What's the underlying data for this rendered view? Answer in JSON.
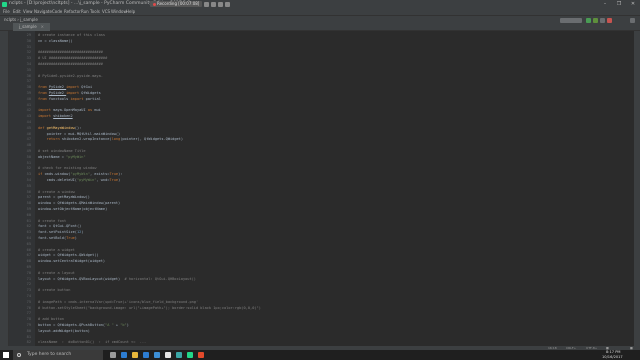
{
  "window": {
    "title": "nclpts - [D:\\project\\ncltpts] - ...\\j_sample - PyCharm Community Edition 2017.2.3",
    "recording_label": "Recording [00:07:08]",
    "icons": [
      "app-icon",
      "record-dot-icon",
      "pause-icon",
      "stop-icon",
      "camera-icon",
      "close-recording-icon"
    ],
    "controls": [
      "–",
      "❐",
      "✕"
    ]
  },
  "menu": [
    "File",
    "Edit",
    "View",
    "Navigate",
    "Code",
    "Refactor",
    "Run",
    "Tools",
    "VCS",
    "Window",
    "Help"
  ],
  "toolbar": {
    "breadcrumb": "nclpts  ›  j_sample",
    "icons": [
      "run-config-icon",
      "run-icon",
      "debug-icon",
      "coverage-icon",
      "stop-icon",
      "search-icon"
    ]
  },
  "tab": {
    "label": "j_sample",
    "close": "×"
  },
  "editor": {
    "lines": [
      {
        "n": "29",
        "parts": [
          {
            "t": "# create instance of this class",
            "c": "c-comment"
          }
        ]
      },
      {
        "n": "30",
        "parts": [
          {
            "t": "cn = className()",
            "c": ""
          }
        ]
      },
      {
        "n": "31",
        "parts": []
      },
      {
        "n": "32",
        "parts": [
          {
            "t": "##############################",
            "c": "c-comment"
          }
        ]
      },
      {
        "n": "33",
        "parts": [
          {
            "t": "# UI ###########################",
            "c": "c-comment"
          }
        ]
      },
      {
        "n": "34",
        "parts": [
          {
            "t": "##############################",
            "c": "c-comment"
          }
        ]
      },
      {
        "n": "35",
        "parts": []
      },
      {
        "n": "36",
        "parts": [
          {
            "t": "# PySide6-pyside2-pyside-maya-",
            "c": "c-comment"
          }
        ]
      },
      {
        "n": "37",
        "parts": []
      },
      {
        "n": "38",
        "parts": [
          {
            "t": "from ",
            "c": "c-kw"
          },
          {
            "t": "PySide2 ",
            "c": "c-ul"
          },
          {
            "t": "import ",
            "c": "c-kw"
          },
          {
            "t": "QtGui",
            "c": ""
          }
        ]
      },
      {
        "n": "39",
        "parts": [
          {
            "t": "from ",
            "c": "c-kw"
          },
          {
            "t": "PySide2 ",
            "c": "c-ul"
          },
          {
            "t": "import ",
            "c": "c-kw"
          },
          {
            "t": "QtWidgets",
            "c": ""
          }
        ]
      },
      {
        "n": "40",
        "parts": [
          {
            "t": "from ",
            "c": "c-kw"
          },
          {
            "t": "functools ",
            "c": ""
          },
          {
            "t": "import ",
            "c": "c-kw"
          },
          {
            "t": "partial",
            "c": ""
          }
        ]
      },
      {
        "n": "41",
        "parts": []
      },
      {
        "n": "42",
        "parts": [
          {
            "t": "import ",
            "c": "c-kw"
          },
          {
            "t": "maya.OpenMayaUI ",
            "c": ""
          },
          {
            "t": "as ",
            "c": "c-kw"
          },
          {
            "t": "mui",
            "c": ""
          }
        ]
      },
      {
        "n": "43",
        "parts": [
          {
            "t": "import ",
            "c": "c-kw"
          },
          {
            "t": "shiboken2",
            "c": "c-ul"
          }
        ]
      },
      {
        "n": "44",
        "parts": []
      },
      {
        "n": "45",
        "parts": [
          {
            "t": "def ",
            "c": "c-kw"
          },
          {
            "t": "getMayaWindow",
            "c": "c-fn"
          },
          {
            "t": "():",
            "c": ""
          }
        ]
      },
      {
        "n": "46",
        "parts": [
          {
            "t": "    pointer = mui.MQtUtil.mainWindow()",
            "c": ""
          }
        ]
      },
      {
        "n": "47",
        "parts": [
          {
            "t": "    return ",
            "c": "c-kw"
          },
          {
            "t": "shiboken2.wrapInstance(",
            "c": ""
          },
          {
            "t": "long",
            "c": "c-kw"
          },
          {
            "t": "(pointer), QtWidgets.QWidget)",
            "c": ""
          }
        ]
      },
      {
        "n": "48",
        "parts": []
      },
      {
        "n": "49",
        "parts": [
          {
            "t": "# set windowName Title",
            "c": "c-comment"
          }
        ]
      },
      {
        "n": "50",
        "parts": [
          {
            "t": "objectName = ",
            "c": ""
          },
          {
            "t": "\"pyMyWin\"",
            "c": "c-str"
          }
        ]
      },
      {
        "n": "51",
        "parts": []
      },
      {
        "n": "52",
        "parts": [
          {
            "t": "# check for existing window",
            "c": "c-comment"
          }
        ]
      },
      {
        "n": "53",
        "parts": [
          {
            "t": "if ",
            "c": "c-kw"
          },
          {
            "t": "cmds.window(",
            "c": ""
          },
          {
            "t": "\"pyMyWin\"",
            "c": "c-str"
          },
          {
            "t": ", exists=",
            "c": ""
          },
          {
            "t": "True",
            "c": "c-kw"
          },
          {
            "t": "):",
            "c": ""
          }
        ]
      },
      {
        "n": "54",
        "parts": [
          {
            "t": "    cmds.deleteUI(",
            "c": ""
          },
          {
            "t": "\"pyMyWin\"",
            "c": "c-str"
          },
          {
            "t": ", wnd=",
            "c": ""
          },
          {
            "t": "True",
            "c": "c-kw"
          },
          {
            "t": ")",
            "c": ""
          }
        ]
      },
      {
        "n": "55",
        "parts": []
      },
      {
        "n": "56",
        "parts": [
          {
            "t": "# create a window",
            "c": "c-comment"
          }
        ]
      },
      {
        "n": "57",
        "parts": [
          {
            "t": "parent = getMayaWindow()",
            "c": ""
          }
        ]
      },
      {
        "n": "58",
        "parts": [
          {
            "t": "window = QtWidgets.QMainWindow(parent)",
            "c": ""
          }
        ]
      },
      {
        "n": "59",
        "parts": [
          {
            "t": "window.setObjectName(objectName)",
            "c": ""
          }
        ]
      },
      {
        "n": "60",
        "parts": []
      },
      {
        "n": "61",
        "parts": [
          {
            "t": "# create font",
            "c": "c-comment"
          }
        ]
      },
      {
        "n": "62",
        "parts": [
          {
            "t": "font = QtGui.QFont()",
            "c": ""
          }
        ]
      },
      {
        "n": "63",
        "parts": [
          {
            "t": "font.setPointSize(",
            "c": ""
          },
          {
            "t": "12",
            "c": "c-num"
          },
          {
            "t": ")",
            "c": ""
          }
        ]
      },
      {
        "n": "64",
        "parts": [
          {
            "t": "font.setBold(",
            "c": ""
          },
          {
            "t": "True",
            "c": "c-kw"
          },
          {
            "t": ")",
            "c": ""
          }
        ]
      },
      {
        "n": "65",
        "parts": []
      },
      {
        "n": "66",
        "parts": [
          {
            "t": "# create a widget",
            "c": "c-comment"
          }
        ]
      },
      {
        "n": "67",
        "parts": [
          {
            "t": "widget = QtWidgets.QWidget()",
            "c": ""
          }
        ]
      },
      {
        "n": "68",
        "parts": [
          {
            "t": "window.setCentralWidget(widget)",
            "c": ""
          }
        ]
      },
      {
        "n": "69",
        "parts": []
      },
      {
        "n": "70",
        "parts": [
          {
            "t": "# create a layout",
            "c": "c-comment"
          }
        ]
      },
      {
        "n": "71",
        "parts": [
          {
            "t": "layout = QtWidgets.QVBoxLayout(widget)  ",
            "c": ""
          },
          {
            "t": "# horizontal: QtGui.QHBoxLayout()",
            "c": "c-comment"
          }
        ]
      },
      {
        "n": "72",
        "parts": []
      },
      {
        "n": "73",
        "parts": [
          {
            "t": "# create button",
            "c": "c-comment"
          }
        ]
      },
      {
        "n": "74",
        "parts": []
      },
      {
        "n": "75",
        "parts": [
          {
            "t": "# imagePath = cmds.internalVar(upd=True)+'icons/blue_field_background.png'",
            "c": "c-comment"
          }
        ]
      },
      {
        "n": "76",
        "parts": [
          {
            "t": "# button.setStyleSheet(\"background-image: url(\"+imagePath+\"); border:solid black 1px;color:rgb(0,0,0)\")",
            "c": "c-comment"
          }
        ]
      },
      {
        "n": "77",
        "parts": []
      },
      {
        "n": "78",
        "parts": [
          {
            "t": "# add button",
            "c": "c-comment"
          }
        ]
      },
      {
        "n": "79",
        "parts": [
          {
            "t": "button = QtWidgets.QPushButton(",
            "c": ""
          },
          {
            "t": "\"A \" ",
            "c": "c-str"
          },
          {
            "t": "+ ",
            "c": ""
          },
          {
            "t": "\"b\"",
            "c": "c-str"
          },
          {
            "t": ")",
            "c": ""
          }
        ]
      },
      {
        "n": "80",
        "parts": [
          {
            "t": "layout.addWidget(button)",
            "c": ""
          }
        ]
      },
      {
        "n": "81",
        "parts": []
      },
      {
        "n": "82",
        "parts": [
          {
            "t": "className  ›  doButton01()  ›  if cmdCount <=  ...",
            "c": "c-comment"
          }
        ]
      }
    ]
  },
  "status": {
    "position": "16:18",
    "line_sep": "CRLF÷",
    "encoding": "UTF-8÷",
    "icons": [
      "lock-icon",
      "event-log-icon"
    ]
  },
  "taskbar": {
    "search_placeholder": "Type here to search",
    "apps": [
      {
        "name": "task-view-icon",
        "color": "#9a9a9a"
      },
      {
        "name": "edge-icon",
        "color": "#2d7dd2"
      },
      {
        "name": "explorer-icon",
        "color": "#e8b73c"
      },
      {
        "name": "store-icon",
        "color": "#2d7dd2"
      },
      {
        "name": "mail-icon",
        "color": "#3d8fd6"
      },
      {
        "name": "unreal-icon",
        "color": "#e6e6e6"
      },
      {
        "name": "maya-icon",
        "color": "#3aa6a6"
      },
      {
        "name": "pycharm-icon",
        "color": "#21d789"
      },
      {
        "name": "browser-icon",
        "color": "#e34a2b"
      }
    ],
    "tray_time": "8:17 PM",
    "tray_date": "10/16/2017"
  },
  "colors": {
    "background": "#2b2b2b",
    "chrome": "#3c3f41",
    "keyword": "#cc7832",
    "string": "#6a8759",
    "comment": "#808080",
    "function": "#ffc66d",
    "number": "#6897bb"
  }
}
